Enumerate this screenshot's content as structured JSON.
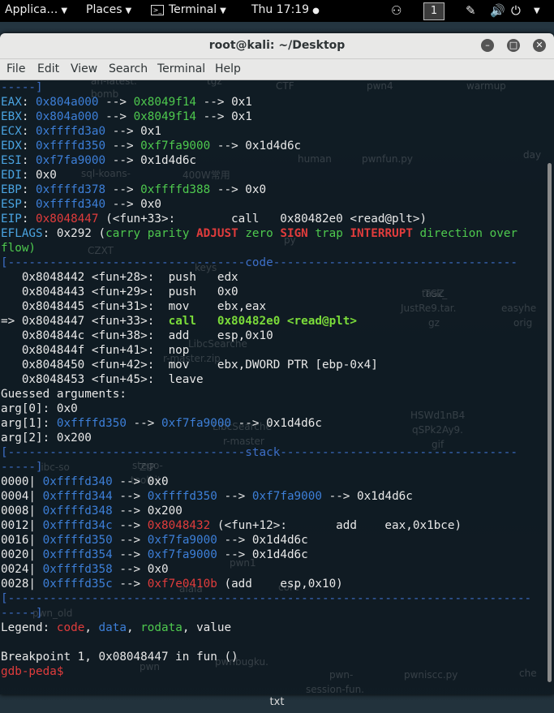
{
  "topbar": {
    "applications": "Applica…",
    "places": "Places",
    "terminal": "Terminal",
    "clock": "Thu 17:19",
    "workspace": "1"
  },
  "window": {
    "title": "root@kali: ~/Desktop"
  },
  "menu": [
    "File",
    "Edit",
    "View",
    "Search",
    "Terminal",
    "Help"
  ],
  "desktop_labels": [
    "an-latest.",
    "tgz",
    "CTF",
    "pwn4",
    "warmup",
    "bomb",
    "human",
    "pwnfun.py",
    "day",
    "sql-koans-",
    "400W常用",
    "py",
    "CZXT",
    "keys",
    "TGZ",
    "task_",
    "JustRe9.tar.",
    "gz",
    "easyhe",
    "orig",
    "LibcSearche",
    "r-master.zip",
    "HSWd1nB4",
    "qSPk2Ay9.",
    "gif",
    "LibcSearche",
    "r-master",
    "stego-",
    "toolkit-",
    "ZIP",
    "libc-so",
    "pwn1",
    "alala",
    "core",
    "pwn_old",
    "pwn",
    "pwnbugku.",
    "pwniscc.py",
    "che",
    "pwn-",
    "session-fun.",
    "txt"
  ],
  "terminal": {
    "sep_top": "-----]",
    "regs": [
      {
        "name": "EAX",
        "v1": "0x804a000",
        "v2": "0x8049f14",
        "v3": "0x1"
      },
      {
        "name": "EBX",
        "v1": "0x804a000",
        "v2": "0x8049f14",
        "v3": "0x1"
      },
      {
        "name": "ECX",
        "v1": "0xffffd3a0",
        "v3": "0x1"
      },
      {
        "name": "EDX",
        "v1": "0xffffd350",
        "v2": "0xf7fa9000",
        "v3": "0x1d4d6c"
      },
      {
        "name": "ESI",
        "v1": "0xf7fa9000",
        "v3": "0x1d4d6c"
      },
      {
        "name": "EDI",
        "plain": "0x0"
      },
      {
        "name": "EBP",
        "v1": "0xffffd378",
        "v2": "0xffffd388",
        "v3": "0x0"
      },
      {
        "name": "ESP",
        "v1": "0xffffd340",
        "v3": "0x0"
      }
    ],
    "eip": {
      "addr": "0x8048447",
      "rest": " (<fun+33>:        call   0x80482e0 <read@plt>)"
    },
    "eflags": {
      "val": "0x292",
      "flags": [
        "carry",
        "parity",
        "ADJUST",
        "zero",
        "SIGN",
        "trap",
        "INTERRUPT",
        "direction",
        "over"
      ],
      "wrap": "flow)"
    },
    "code_header": "[----------------------------------code-----------------------------------",
    "code": [
      {
        "arrow": "   ",
        "addr": "0x8048442",
        "sym": "<fun+28>:",
        "op": "push",
        "args": "edx"
      },
      {
        "arrow": "   ",
        "addr": "0x8048443",
        "sym": "<fun+29>:",
        "op": "push",
        "args": "0x0"
      },
      {
        "arrow": "   ",
        "addr": "0x8048445",
        "sym": "<fun+31>:",
        "op": "mov",
        "args": "ebx,eax"
      },
      {
        "arrow": "=> ",
        "addr": "0x8048447",
        "sym": "<fun+33>:",
        "op": "call",
        "args": "0x80482e0 <read@plt>",
        "current": true
      },
      {
        "arrow": "   ",
        "addr": "0x804844c",
        "sym": "<fun+38>:",
        "op": "add",
        "args": "esp,0x10"
      },
      {
        "arrow": "   ",
        "addr": "0x804844f",
        "sym": "<fun+41>:",
        "op": "nop",
        "args": ""
      },
      {
        "arrow": "   ",
        "addr": "0x8048450",
        "sym": "<fun+42>:",
        "op": "mov",
        "args": "ebx,DWORD PTR [ebp-0x4]"
      },
      {
        "arrow": "   ",
        "addr": "0x8048453",
        "sym": "<fun+45>:",
        "op": "leave",
        "args": ""
      }
    ],
    "guessed": "Guessed arguments:",
    "args": [
      {
        "k": "arg[0]",
        "plain": "0x0"
      },
      {
        "k": "arg[1]",
        "v1": "0xffffd350",
        "v2": "0xf7fa9000",
        "v3": "0x1d4d6c"
      },
      {
        "k": "arg[2]",
        "plain": "0x200"
      }
    ],
    "stack_header": "[----------------------------------stack----------------------------------",
    "stack": [
      {
        "off": "0000",
        "a": "0xffffd340",
        "plain": "0x0"
      },
      {
        "off": "0004",
        "a": "0xffffd344",
        "b": "0xffffd350",
        "c": "0xf7fa9000",
        "d": "0x1d4d6c"
      },
      {
        "off": "0008",
        "a": "0xffffd348",
        "plain": "0x200"
      },
      {
        "off": "0012",
        "a": "0xffffd34c",
        "red": "0x8048432",
        "tail": " (<fun+12>:       add    eax,0x1bce)"
      },
      {
        "off": "0016",
        "a": "0xffffd350",
        "b": "0xf7fa9000",
        "d": "0x1d4d6c"
      },
      {
        "off": "0020",
        "a": "0xffffd354",
        "b": "0xf7fa9000",
        "d": "0x1d4d6c"
      },
      {
        "off": "0024",
        "a": "0xffffd358",
        "plain": "0x0"
      },
      {
        "off": "0028",
        "a": "0xffffd35c",
        "red": "0xf7e0410b",
        "tail": " (add    esp,0x10)"
      }
    ],
    "sep_bottom": "[---------------------------------------------------------------------------",
    "sep_bottom2": "-----]",
    "legend": {
      "prefix": "Legend: ",
      "code": "code",
      "data": "data",
      "rodata": "rodata",
      "value": "value"
    },
    "breakpoint": "Breakpoint 1, 0x08048447 in fun ()",
    "prompt": "gdb-peda$"
  }
}
